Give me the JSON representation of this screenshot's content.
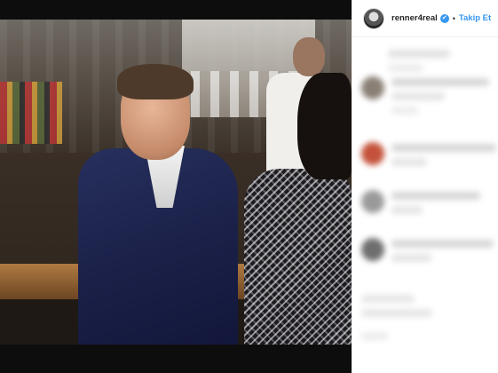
{
  "post": {
    "username": "renner4real",
    "verified_mark": "✔",
    "separator": "•",
    "follow_label": "Takip Et"
  },
  "icons": {
    "avatar": "profile-avatar",
    "verified": "verified-badge-icon"
  },
  "colors": {
    "accent": "#3897f0",
    "text": "#262626",
    "media_bg": "#0d0d0d"
  }
}
